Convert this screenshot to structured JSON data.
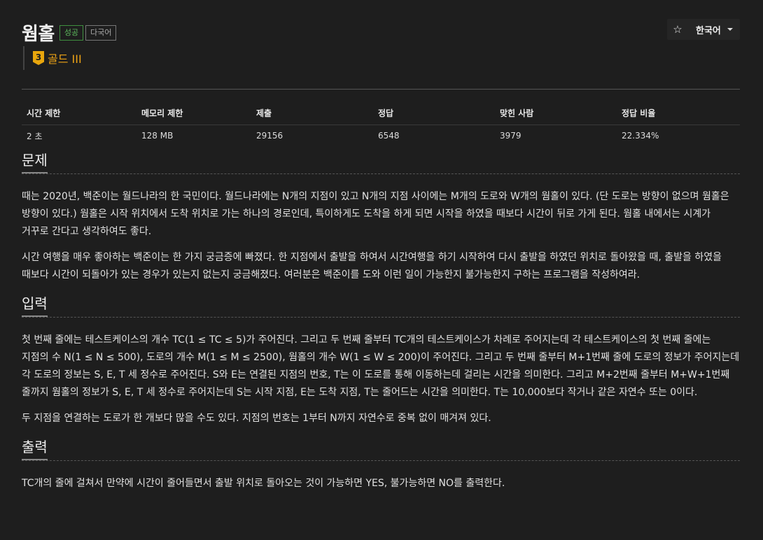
{
  "problem": {
    "title": "웜홀",
    "badge_success": "성공",
    "badge_multilang": "다국어",
    "tier_number": "3",
    "tier_label": "골드 III"
  },
  "language": {
    "label": "한국어"
  },
  "stats": {
    "headers": [
      "시간 제한",
      "메모리 제한",
      "제출",
      "정답",
      "맞힌 사람",
      "정답 비율"
    ],
    "values": [
      "2 초",
      "128 MB",
      "29156",
      "6548",
      "3979",
      "22.334%"
    ]
  },
  "sections": {
    "description": {
      "heading": "문제",
      "paragraphs": [
        "때는 2020년, 백준이는 월드나라의 한 국민이다. 월드나라에는 N개의 지점이 있고 N개의 지점 사이에는 M개의 도로와 W개의 웜홀이 있다. (단 도로는 방향이 없으며 웜홀은 방향이 있다.) 웜홀은 시작 위치에서 도착 위치로 가는 하나의 경로인데, 특이하게도 도착을 하게 되면 시작을 하였을 때보다 시간이 뒤로 가게 된다. 웜홀 내에서는 시계가 거꾸로 간다고 생각하여도 좋다.",
        "시간 여행을 매우 좋아하는 백준이는 한 가지 궁금증에 빠졌다. 한 지점에서 출발을 하여서 시간여행을 하기 시작하여 다시 출발을 하였던 위치로 돌아왔을 때, 출발을 하였을 때보다 시간이 되돌아가 있는 경우가 있는지 없는지 궁금해졌다. 여러분은 백준이를 도와 이런 일이 가능한지 불가능한지 구하는 프로그램을 작성하여라."
      ]
    },
    "input": {
      "heading": "입력",
      "paragraphs": [
        "첫 번째 줄에는 테스트케이스의 개수 TC(1 ≤ TC ≤ 5)가 주어진다. 그리고 두 번째 줄부터 TC개의 테스트케이스가 차례로 주어지는데 각 테스트케이스의 첫 번째 줄에는 지점의 수 N(1 ≤ N ≤ 500), 도로의 개수 M(1 ≤ M ≤ 2500), 웜홀의 개수 W(1 ≤ W ≤ 200)이 주어진다. 그리고 두 번째 줄부터 M+1번째 줄에 도로의 정보가 주어지는데 각 도로의 정보는 S, E, T 세 정수로 주어진다. S와 E는 연결된 지점의 번호, T는 이 도로를 통해 이동하는데 걸리는 시간을 의미한다. 그리고 M+2번째 줄부터 M+W+1번째 줄까지 웜홀의 정보가 S, E, T 세 정수로 주어지는데 S는 시작 지점, E는 도착 지점, T는 줄어드는 시간을 의미한다. T는 10,000보다 작거나 같은 자연수 또는 0이다.",
        "두 지점을 연결하는 도로가 한 개보다 많을 수도 있다. 지점의 번호는 1부터 N까지 자연수로 중복 없이 매겨져 있다."
      ]
    },
    "output": {
      "heading": "출력",
      "paragraphs": [
        "TC개의 줄에 걸쳐서 만약에 시간이 줄어들면서 출발 위치로 돌아오는 것이 가능하면 YES, 불가능하면 NO를 출력한다."
      ]
    }
  }
}
